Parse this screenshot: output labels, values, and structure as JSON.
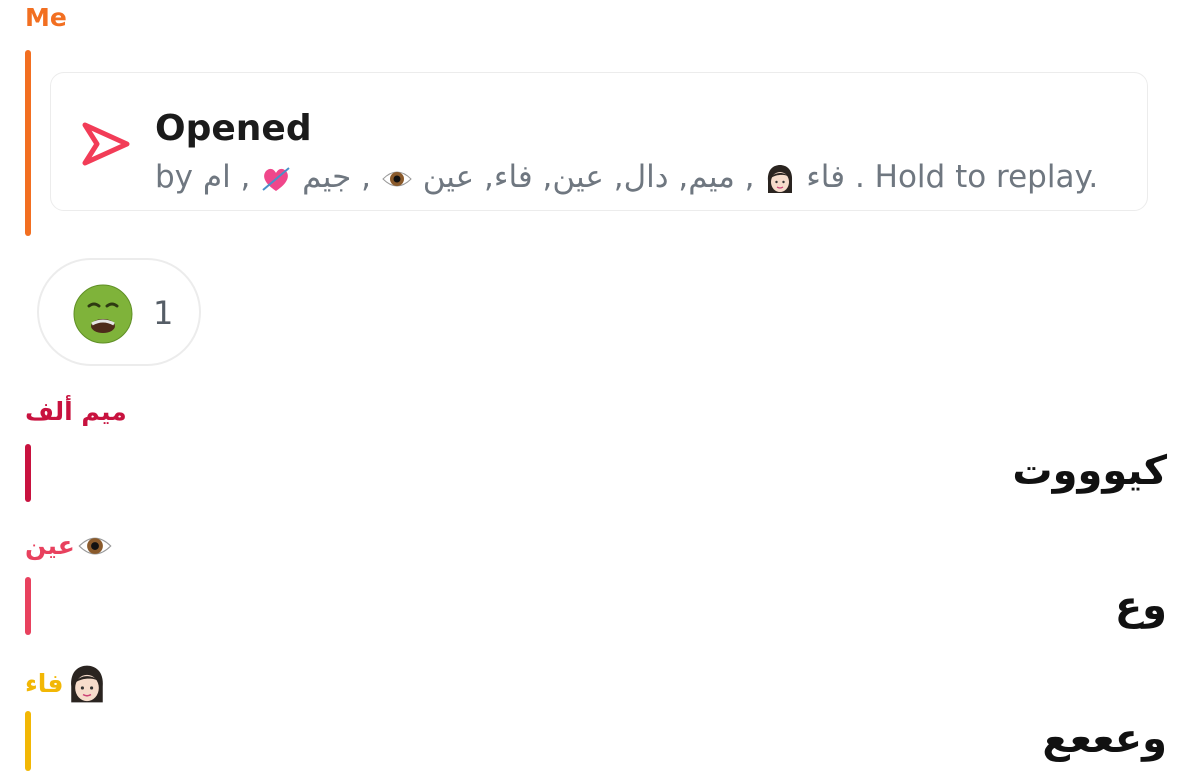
{
  "colors": {
    "me": "#f26f21",
    "sender1": "#c8123f",
    "sender2": "#e8415e",
    "sender3": "#f2b705",
    "replay_icon": "#f23c57",
    "subtitle": "#6f7780"
  },
  "messages": [
    {
      "sender": "Me",
      "card": {
        "icon": "open-arrow-icon",
        "title": "Opened",
        "subtitle_prefix": "by",
        "subtitle_names": "فاء",
        "subtitle_names2": ", ميم, دال, عين, فاء, عين",
        "subtitle_names3": ", جيم",
        "subtitle_names4": ", ام",
        "subtitle_suffix": ". Hold to replay."
      },
      "reaction": {
        "emoji": "nauseated-face-icon",
        "count": "1"
      }
    },
    {
      "sender": "ميم ألف",
      "text": "كيوووت"
    },
    {
      "sender": "عين",
      "sender_emoji": "eye-icon",
      "text": "وع"
    },
    {
      "sender": "فاء",
      "sender_emoji": "woman-face-icon",
      "text": "وعععع"
    }
  ]
}
